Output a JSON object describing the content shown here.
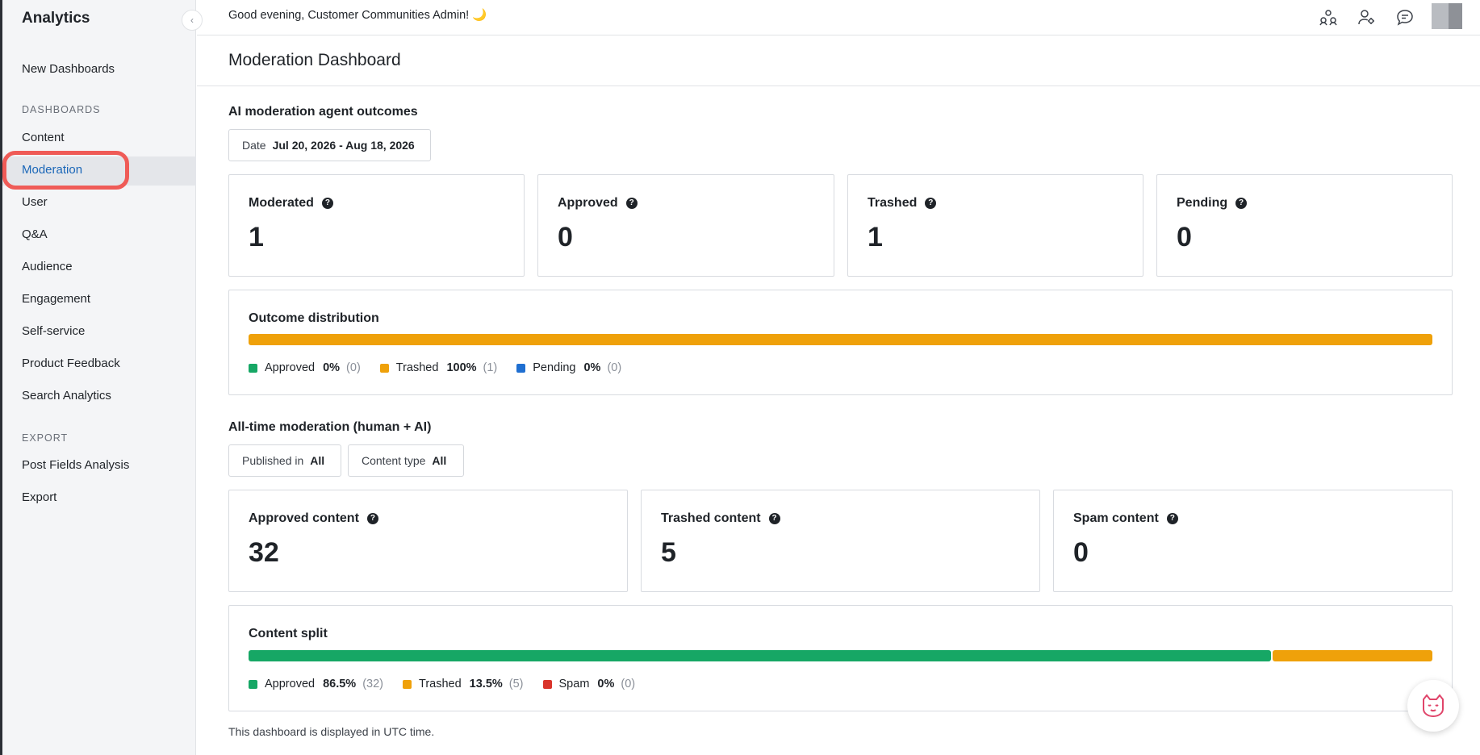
{
  "sidebar": {
    "title": "Analytics",
    "new_dashboards": "New Dashboards",
    "dashboards_section": "DASHBOARDS",
    "items": [
      "Content",
      "Moderation",
      "User",
      "Q&A",
      "Audience",
      "Engagement",
      "Self-service",
      "Product Feedback",
      "Search Analytics"
    ],
    "active_item": "Moderation",
    "export_section": "EXPORT",
    "export_items": [
      "Post Fields Analysis",
      "Export"
    ],
    "collapse_glyph": "‹"
  },
  "topbar": {
    "greeting": "Good evening, Customer Communities Admin! 🌙",
    "icons": [
      "community-icon",
      "user-settings-icon",
      "chat-icon",
      "avatar"
    ]
  },
  "page": {
    "title": "Moderation Dashboard"
  },
  "ai_section": {
    "title": "AI moderation agent outcomes",
    "date_filter": {
      "label": "Date",
      "value": "Jul 20, 2026 - Aug 18, 2026"
    },
    "cards": [
      {
        "label": "Moderated",
        "value": "1"
      },
      {
        "label": "Approved",
        "value": "0"
      },
      {
        "label": "Trashed",
        "value": "1"
      },
      {
        "label": "Pending",
        "value": "0"
      }
    ],
    "distribution": {
      "title": "Outcome distribution",
      "segments": [
        {
          "name": "Approved",
          "pct": "0%",
          "count": "(0)",
          "fraction": 0,
          "color": "#16a765"
        },
        {
          "name": "Trashed",
          "pct": "100%",
          "count": "(1)",
          "fraction": 1,
          "color": "#efa10a"
        },
        {
          "name": "Pending",
          "pct": "0%",
          "count": "(0)",
          "fraction": 0,
          "color": "#1f6fd1"
        }
      ]
    }
  },
  "all_time_section": {
    "title": "All-time moderation (human + AI)",
    "filters": [
      {
        "label": "Published in",
        "value": "All"
      },
      {
        "label": "Content type",
        "value": "All"
      }
    ],
    "cards": [
      {
        "label": "Approved content",
        "value": "32"
      },
      {
        "label": "Trashed content",
        "value": "5"
      },
      {
        "label": "Spam content",
        "value": "0"
      }
    ],
    "split": {
      "title": "Content split",
      "segments": [
        {
          "name": "Approved",
          "pct": "86.5%",
          "count": "(32)",
          "fraction": 0.865,
          "color": "#16a765"
        },
        {
          "name": "Trashed",
          "pct": "13.5%",
          "count": "(5)",
          "fraction": 0.135,
          "color": "#efa10a"
        },
        {
          "name": "Spam",
          "pct": "0%",
          "count": "(0)",
          "fraction": 0,
          "color": "#d9342b"
        }
      ]
    }
  },
  "footnote": "This dashboard is displayed in UTC time.",
  "help_glyph": "?"
}
